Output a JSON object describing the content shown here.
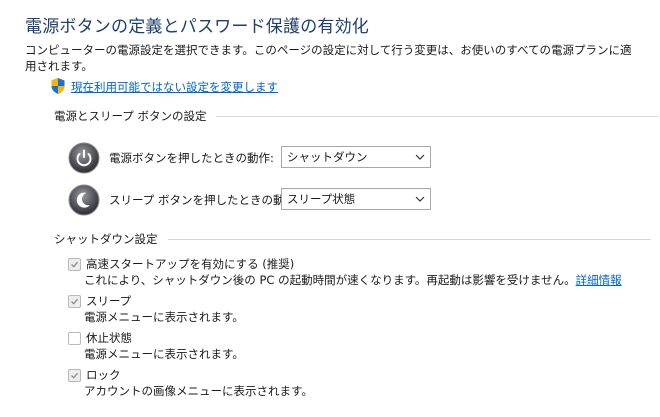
{
  "header": {
    "title": "電源ボタンの定義とパスワード保護の有効化",
    "description": "コンピューターの電源設定を選択できます。このページの設定に対して行う変更は、お使いのすべての電源プランに適用されます。",
    "change_link": "現在利用可能ではない設定を変更します"
  },
  "power_section": {
    "heading": "電源とスリープ ボタンの設定",
    "rows": [
      {
        "label": "電源ボタンを押したときの動作:",
        "value": "シャットダウン",
        "icon": "power-icon"
      },
      {
        "label": "スリープ ボタンを押したときの動作:",
        "value": "スリープ状態",
        "icon": "sleep-icon"
      }
    ]
  },
  "shutdown_section": {
    "heading": "シャットダウン設定",
    "items": [
      {
        "label": "高速スタートアップを有効にする (推奨)",
        "checked": true,
        "description": "これにより、シャットダウン後の PC の起動時間が速くなります。再起動は影響を受けません。",
        "link": "詳細情報"
      },
      {
        "label": "スリープ",
        "checked": true,
        "description": "電源メニューに表示されます。"
      },
      {
        "label": "休止状態",
        "checked": false,
        "description": "電源メニューに表示されます。"
      },
      {
        "label": "ロック",
        "checked": true,
        "description": "アカウントの画像メニューに表示されます。"
      }
    ]
  },
  "colors": {
    "title": "#1e3f6e",
    "link": "#0066cc"
  }
}
